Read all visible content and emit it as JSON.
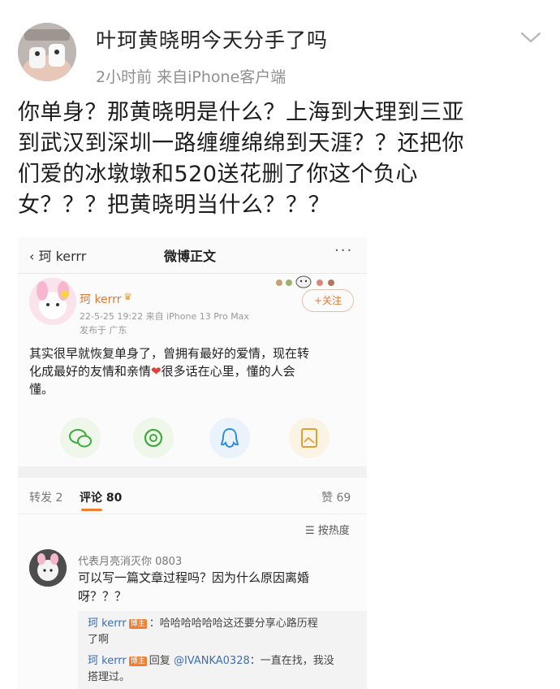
{
  "post": {
    "title": "叶珂黄晓明今天分手了吗",
    "meta": "2小时前  来自iPhone客户端",
    "body_lines": [
      "你单身？那黄晓明是什么？上海到大理到三亚",
      "到武汉到深圳一路缠缠绵绵到天涯？？还把你",
      "们爱的冰墩墩和520送花删了你这个负心",
      "女？？？把黄晓明当什么？？？"
    ]
  },
  "embedded": {
    "nav": {
      "back": "珂 kerrr",
      "title": "微博正文",
      "more": "···"
    },
    "author": {
      "name": "珂 kerrr",
      "time": "22-5-25 19:22  来自 iPhone 13 Pro Max",
      "location": "发布于 广东",
      "follow": "+关注"
    },
    "text_lines": [
      "其实很早就恢复单身了，曾拥有最好的爱情，现在转",
      "化成最好的友情和亲情",
      "很多话在心里，懂的人会",
      "懂。"
    ],
    "heart": "❤",
    "tabs": {
      "repost": "转发 2",
      "comment": "评论 80",
      "like": "赞 69"
    },
    "sort": "按热度",
    "comment": {
      "name": "代表月亮消灭你 0803",
      "text_lines": [
        "可以写一篇文章过程吗？因为什么原因离婚",
        "呀？？？"
      ]
    },
    "replies": [
      {
        "name": "珂 kerrr",
        "badge": "博主",
        "text_lines": [
          "：哈哈哈哈哈哈这还要分享心路历程",
          "了啊"
        ]
      },
      {
        "name": "珂 kerrr",
        "badge": "博主",
        "reply_word": "回复",
        "at": "@IVANKA0328",
        "text_lines": [
          "：一直在找，我没",
          "搭理过。"
        ]
      }
    ]
  },
  "icons": {
    "chevron": "chevron-down-icon",
    "share": [
      "wechat-icon",
      "moments-icon",
      "qq-icon",
      "save-image-icon"
    ]
  },
  "colors": {
    "accent": "#f08030",
    "link": "#3a6fb0",
    "muted": "#8f8f8f"
  }
}
